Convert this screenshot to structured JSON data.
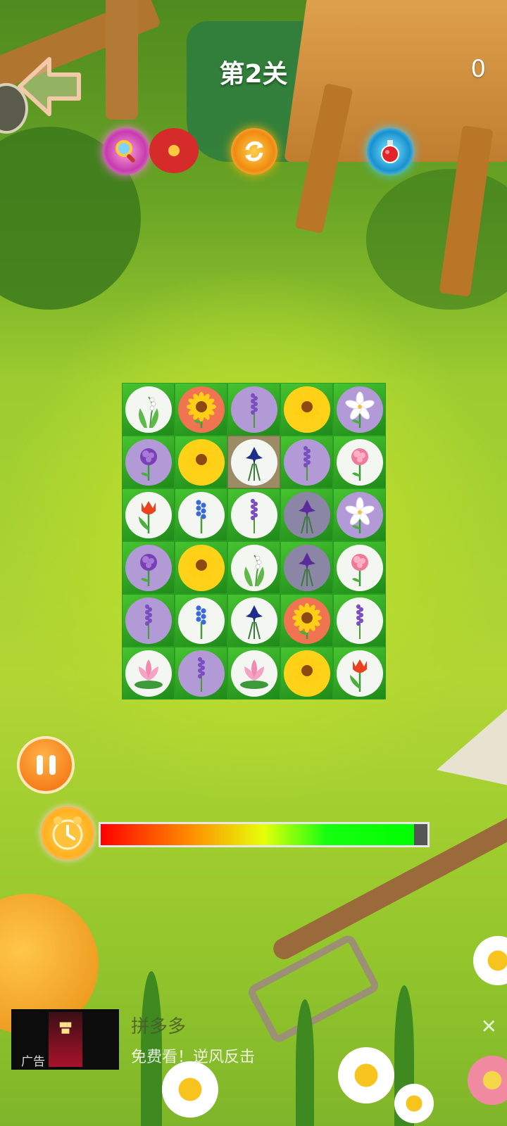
{
  "header": {
    "level_title": "第2关",
    "score": "0",
    "back_icon": "back-arrow-icon"
  },
  "powerups": [
    {
      "name": "hint",
      "icon": "magnifier-icon"
    },
    {
      "name": "shuffle",
      "icon": "shuffle-icon"
    },
    {
      "name": "potion",
      "icon": "potion-icon"
    }
  ],
  "board": {
    "rows": 6,
    "cols": 5,
    "selected": [
      1,
      2
    ],
    "tiles": [
      [
        "lily-of-the-valley",
        "sunflower-orange",
        "lavender",
        "sunflower",
        "lily"
      ],
      [
        "carnation-purple",
        "sunflower",
        "iris",
        "lavender",
        "carnation-pink"
      ],
      [
        "tulip",
        "hyacinth",
        "lavender-white",
        "iris-grey",
        "lily"
      ],
      [
        "carnation-purple",
        "sunflower",
        "lily-of-the-valley",
        "iris-grey",
        "carnation-pink"
      ],
      [
        "lavender",
        "hyacinth",
        "iris",
        "sunflower-orange",
        "lavender-white"
      ],
      [
        "lotus",
        "lavender",
        "lotus",
        "sunflower",
        "tulip"
      ]
    ]
  },
  "timer": {
    "remaining_fraction": 0.96,
    "clock_icon": "alarm-clock-icon"
  },
  "pause_icon": "pause-icon",
  "ad": {
    "tag": "广告",
    "title": "拼多多",
    "subtitle": "免费看！逆风反击",
    "close_symbol": "✕"
  },
  "colors": {
    "tile_green": "#2fa524",
    "tile_selected": "#9b8c66",
    "disc_white": "#f4f6f2",
    "disc_purple": "#b29ad6",
    "disc_yellow": "#ffd21a",
    "disc_orange": "#f07352",
    "disc_grey": "#8c86a6"
  }
}
